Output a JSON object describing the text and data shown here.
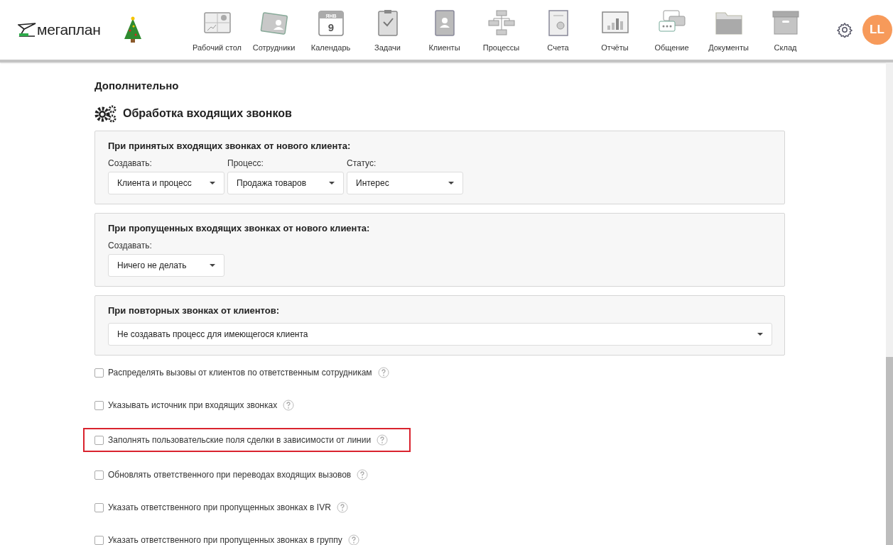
{
  "header": {
    "logo": "мегаплан",
    "nav": [
      {
        "label": "Рабочий стол"
      },
      {
        "label": "Сотрудники"
      },
      {
        "label": "Календарь",
        "icon_text": "9",
        "icon_month": "ЯНВ"
      },
      {
        "label": "Задачи"
      },
      {
        "label": "Клиенты"
      },
      {
        "label": "Процессы"
      },
      {
        "label": "Счета"
      },
      {
        "label": "Отчёты"
      },
      {
        "label": "Общение"
      },
      {
        "label": "Документы"
      },
      {
        "label": "Склад"
      }
    ],
    "avatar": "LL"
  },
  "section_title": "Дополнительно",
  "subsection_title": "Обработка входящих звонков",
  "panels": [
    {
      "title": "При принятых входящих звонках от нового клиента:",
      "fields": [
        {
          "label": "Создавать:",
          "value": "Клиента и процесс"
        },
        {
          "label": "Процесс:",
          "value": "Продажа товаров"
        },
        {
          "label": "Статус:",
          "value": "Интерес"
        }
      ]
    },
    {
      "title": "При пропущенных входящих звонках от нового клиента:",
      "fields": [
        {
          "label": "Создавать:",
          "value": "Ничего не делать"
        }
      ]
    },
    {
      "title": "При повторных звонках от клиентов:",
      "fields": [
        {
          "value": "Не создавать процесс для имеющегося клиента"
        }
      ]
    }
  ],
  "options": [
    {
      "label": "Распределять вызовы от клиентов по ответственным сотрудникам",
      "checked": false,
      "highlighted": false
    },
    {
      "label": "Указывать источник при входящих звонках",
      "checked": false,
      "highlighted": false
    },
    {
      "label": "Заполнять пользовательские поля сделки в зависимости от линии",
      "checked": false,
      "highlighted": true
    },
    {
      "label": "Обновлять ответственного при переводах входящих вызовов",
      "checked": false,
      "highlighted": false
    },
    {
      "label": "Указать ответственного при пропущенных звонках в IVR",
      "checked": false,
      "highlighted": false
    },
    {
      "label": "Указать ответственного при пропущенных звонках в группу",
      "checked": false,
      "highlighted": false
    }
  ]
}
